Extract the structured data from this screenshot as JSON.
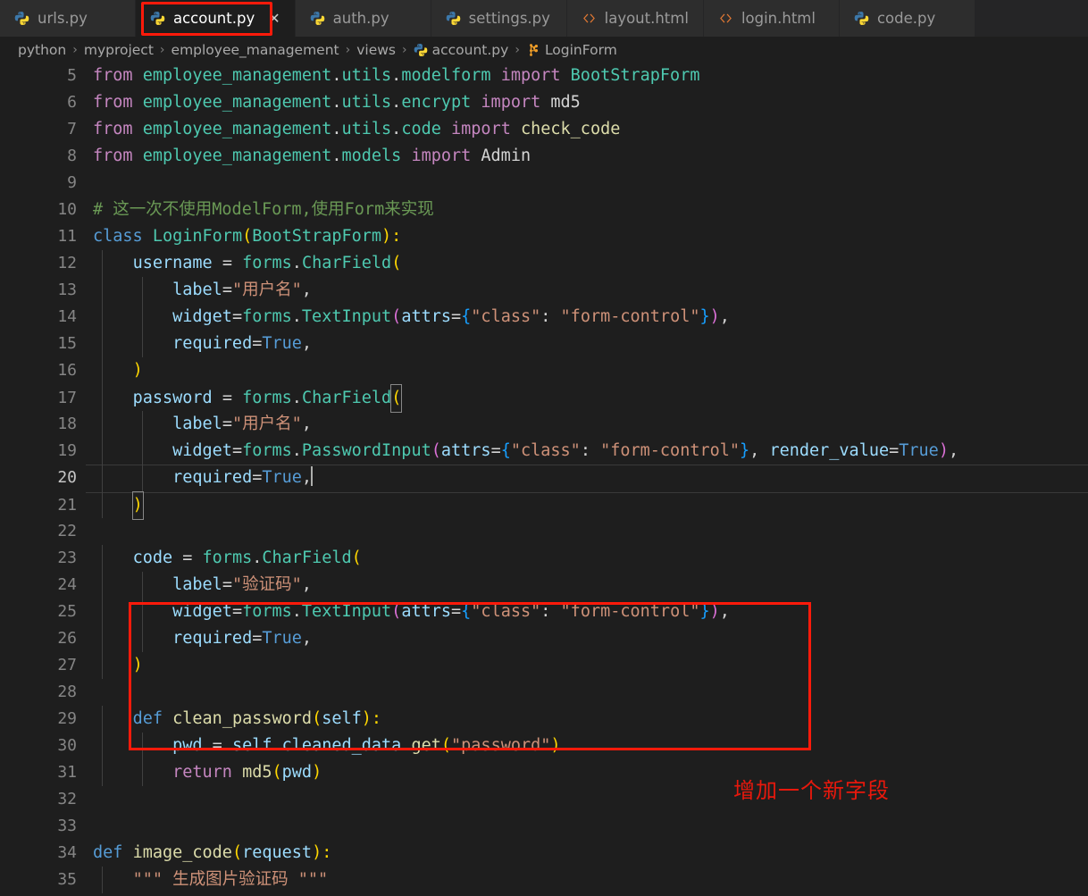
{
  "window": {
    "theme_background": "#1e1e1e",
    "accent_annotation_color": "#ff1a0a"
  },
  "tabs": [
    {
      "label": "urls.py",
      "icon": "python-icon",
      "active": false,
      "closable": false
    },
    {
      "label": "account.py",
      "icon": "python-icon",
      "active": true,
      "closable": true,
      "close_label": "✕"
    },
    {
      "label": "auth.py",
      "icon": "python-icon",
      "active": false,
      "closable": false
    },
    {
      "label": "settings.py",
      "icon": "python-icon",
      "active": false,
      "closable": false
    },
    {
      "label": "layout.html",
      "icon": "html-icon",
      "active": false,
      "closable": false
    },
    {
      "label": "login.html",
      "icon": "html-icon",
      "active": false,
      "closable": false
    },
    {
      "label": "code.py",
      "icon": "python-icon",
      "active": false,
      "closable": false
    }
  ],
  "breadcrumb": {
    "separator": "›",
    "items": [
      {
        "label": "python",
        "icon": null
      },
      {
        "label": "myproject",
        "icon": null
      },
      {
        "label": "employee_management",
        "icon": null
      },
      {
        "label": "views",
        "icon": null
      },
      {
        "label": "account.py",
        "icon": "python-icon"
      },
      {
        "label": "LoginForm",
        "icon": "class-icon"
      }
    ]
  },
  "editor": {
    "active_line": 20,
    "first_visible_line": 5,
    "last_visible_line": 35,
    "cursor_line": 20,
    "cursor_after_text": "required=True,",
    "lines": [
      {
        "n": 5,
        "text": "from employee_management.utils.modelform import BootStrapForm"
      },
      {
        "n": 6,
        "text": "from employee_management.utils.encrypt import md5"
      },
      {
        "n": 7,
        "text": "from employee_management.utils.code import check_code"
      },
      {
        "n": 8,
        "text": "from employee_management.models import Admin"
      },
      {
        "n": 9,
        "text": ""
      },
      {
        "n": 10,
        "text": "# 这一次不使用ModelForm,使用Form来实现"
      },
      {
        "n": 11,
        "text": "class LoginForm(BootStrapForm):"
      },
      {
        "n": 12,
        "text": "    username = forms.CharField("
      },
      {
        "n": 13,
        "text": "        label=\"用户名\","
      },
      {
        "n": 14,
        "text": "        widget=forms.TextInput(attrs={\"class\": \"form-control\"}),"
      },
      {
        "n": 15,
        "text": "        required=True,"
      },
      {
        "n": 16,
        "text": "    )"
      },
      {
        "n": 17,
        "text": "    password = forms.CharField("
      },
      {
        "n": 18,
        "text": "        label=\"用户名\","
      },
      {
        "n": 19,
        "text": "        widget=forms.PasswordInput(attrs={\"class\": \"form-control\"}, render_value=True),"
      },
      {
        "n": 20,
        "text": "        required=True,"
      },
      {
        "n": 21,
        "text": "    )"
      },
      {
        "n": 22,
        "text": ""
      },
      {
        "n": 23,
        "text": "    code = forms.CharField("
      },
      {
        "n": 24,
        "text": "        label=\"验证码\","
      },
      {
        "n": 25,
        "text": "        widget=forms.TextInput(attrs={\"class\": \"form-control\"}),"
      },
      {
        "n": 26,
        "text": "        required=True,"
      },
      {
        "n": 27,
        "text": "    )"
      },
      {
        "n": 28,
        "text": ""
      },
      {
        "n": 29,
        "text": "    def clean_password(self):"
      },
      {
        "n": 30,
        "text": "        pwd = self.cleaned_data.get(\"password\")"
      },
      {
        "n": 31,
        "text": "        return md5(pwd)"
      },
      {
        "n": 32,
        "text": ""
      },
      {
        "n": 33,
        "text": ""
      },
      {
        "n": 34,
        "text": "def image_code(request):"
      },
      {
        "n": 35,
        "text": "    \"\"\" 生成图片验证码 \"\"\""
      }
    ]
  },
  "annotations": {
    "tab_box": {
      "target": "account.py tab",
      "color": "#ff1a0a"
    },
    "code_box": {
      "target_lines": "23-27",
      "color": "#ff1a0a"
    },
    "note_text": "增加一个新字段",
    "note_color": "#e8180c"
  }
}
